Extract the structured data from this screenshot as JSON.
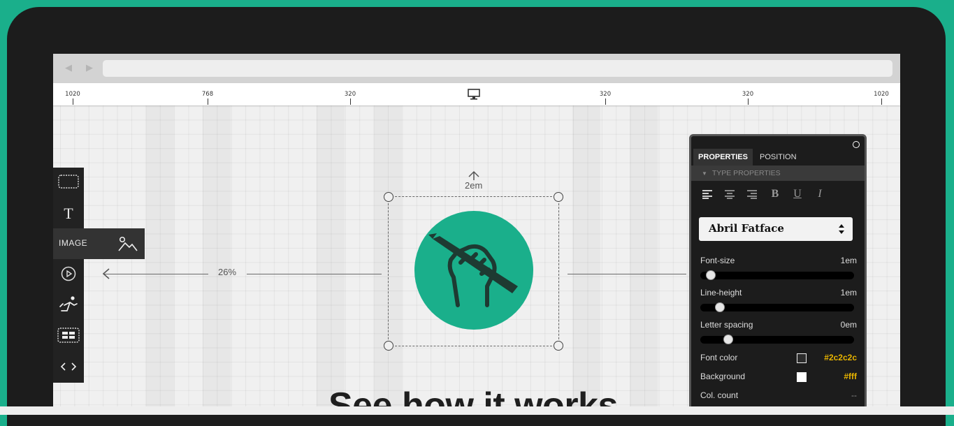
{
  "browser": {
    "back": "◀",
    "forward": "▶",
    "url": ""
  },
  "ruler": {
    "ticks": [
      "1020",
      "768",
      "320",
      "320",
      "320",
      "1020"
    ],
    "device_icon": "desktop-icon"
  },
  "toolbar": {
    "items": [
      "rectangle-tool-icon",
      "text-tool-icon",
      "image-tool-icon",
      "video-tool-icon",
      "animation-tool-icon",
      "grid-tool-icon",
      "code-tool-icon"
    ],
    "text_label": "T",
    "flyout_label": "IMAGE"
  },
  "canvas": {
    "left_margin": "26%",
    "top_margin": "2em",
    "headline": "See how it works"
  },
  "panel": {
    "tabs": [
      "PROPERTIES",
      "POSITION"
    ],
    "section": "TYPE PROPERTIES",
    "format_bold": "B",
    "format_underline": "U",
    "format_italic": "I",
    "font_family": "Abril Fatface",
    "props": {
      "font_size": {
        "label": "Font-size",
        "value": "1em",
        "level": 0.04
      },
      "line_height": {
        "label": "Line-height",
        "value": "1em",
        "level": 0.1
      },
      "letter_spacing": {
        "label": "Letter spacing",
        "value": "0em",
        "level": 0.16
      }
    },
    "font_color": {
      "label": "Font color",
      "value": "#2c2c2c"
    },
    "background": {
      "label": "Background",
      "value": "#fff"
    },
    "col_count": {
      "label": "Col. count",
      "value": "--"
    }
  },
  "colors": {
    "brand": "#1aaf8b",
    "hex_accent": "#e8b400",
    "device": "#1c1c1c"
  }
}
